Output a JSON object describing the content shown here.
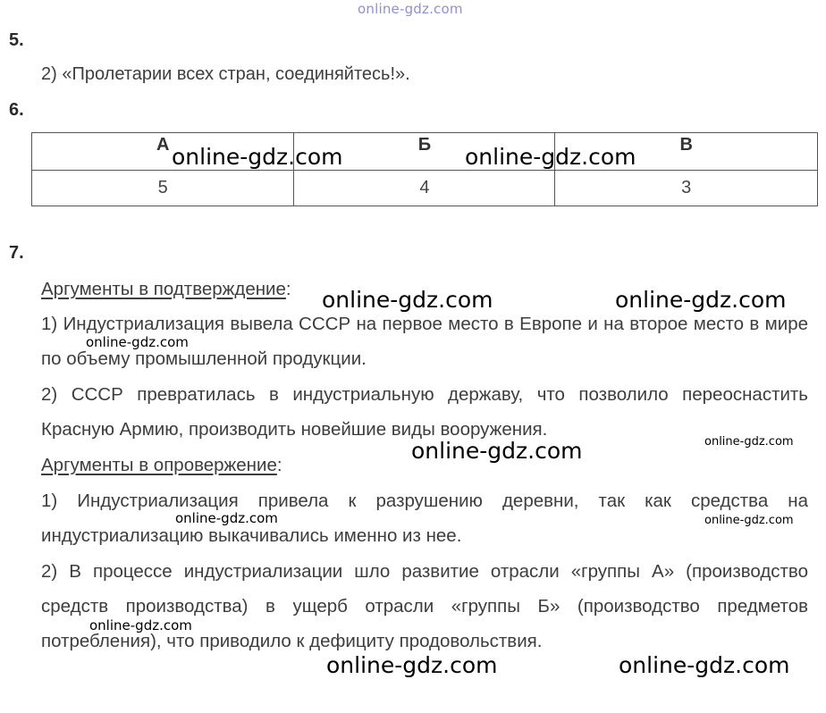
{
  "watermark_top": "online-gdz.com",
  "q5": {
    "number": "5.",
    "answer": "2) «Пролетарии всех стран, соединяйтесь!»."
  },
  "q6": {
    "number": "6.",
    "headers": [
      "А",
      "Б",
      "В"
    ],
    "values": [
      "5",
      "4",
      "3"
    ]
  },
  "q7": {
    "number": "7.",
    "pro_heading": "Аргументы в подтверждение",
    "pro_items": [
      "1) Индустриализация вывела СССР на первое место в Европе и на второе место в мире по объему промышленной продукции.",
      "2) СССР превратилась в индустриальную державу, что позволило переоснастить Красную Армию, производить новейшие виды вооружения."
    ],
    "contra_heading": "Аргументы в опровержение",
    "contra_items": [
      "1) Индустриализация привела к разрушению деревни, так как средства на индустриализацию выкачивались именно из нее.",
      "2) В процессе индустриализации шло развитие отрасли «группы А» (производство средств производства) в ущерб отрасли «группы Б» (производство предметов потребления), что приводило к дефициту продовольствия."
    ],
    "colon": ":"
  },
  "watermark": "online-gdz.com"
}
